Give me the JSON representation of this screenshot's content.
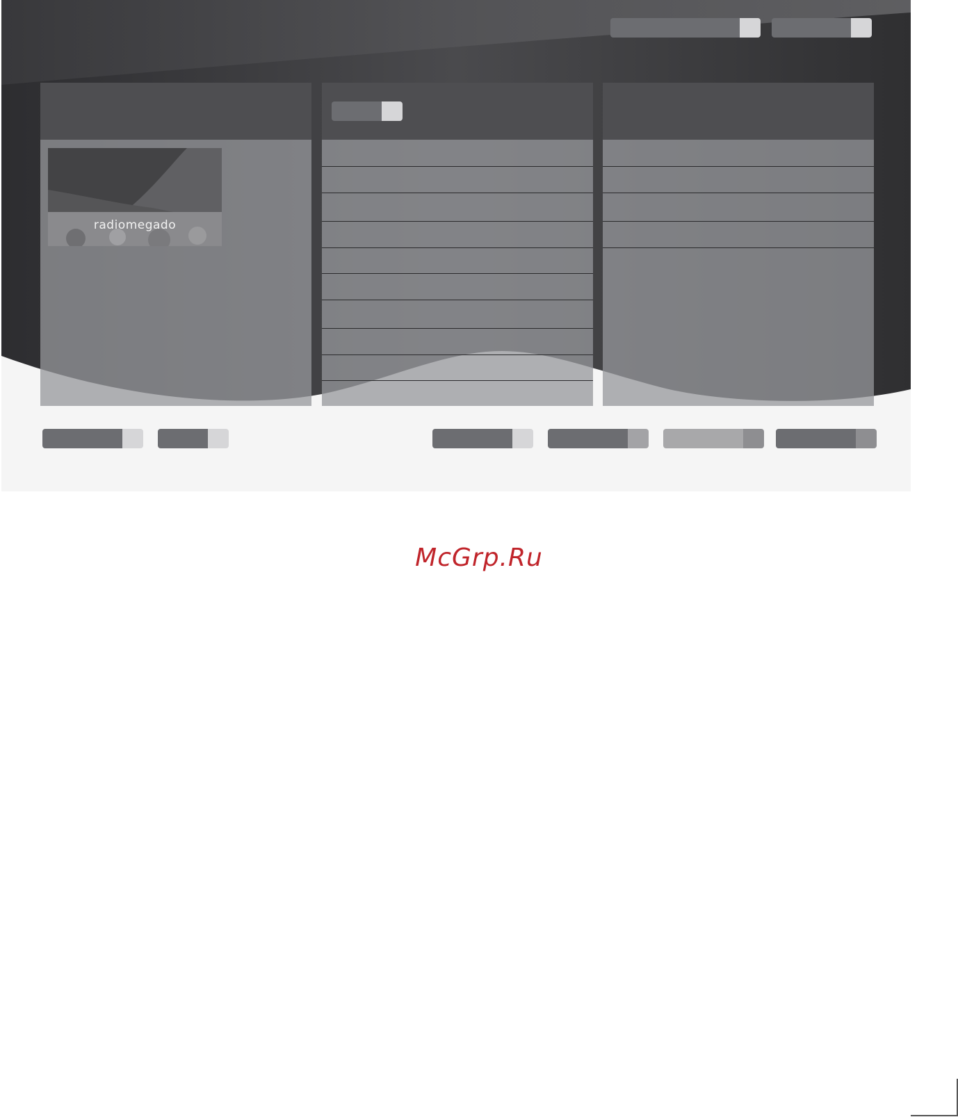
{
  "overlay": {
    "brand_text": "radiomegado"
  },
  "watermark": {
    "text": "McGrp.Ru"
  },
  "colors": {
    "dark_bg": "#3a3a3d",
    "panel": "#7b7c80",
    "panel_head": "#4e4e51",
    "pill_dark": "#6c6d71",
    "pill_key_light": "#d6d6d8",
    "pill_key_mid": "#a3a3a6",
    "pill_light": "#a8a8aa",
    "watermark_red": "#c0242a"
  },
  "icons": {
    "corner_mark": "corner-bracket-icon"
  }
}
